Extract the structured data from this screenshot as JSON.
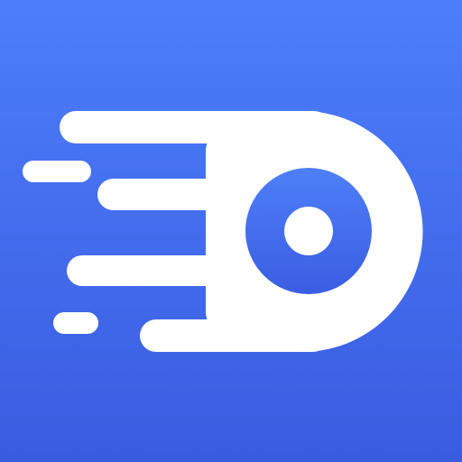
{
  "icon": {
    "name": "speed-disc-logo",
    "colors": {
      "background_top": "#4C7EFB",
      "background_bottom": "#3A5CE0",
      "glyph": "#FFFFFF",
      "ring_top": "#4E7FF8",
      "ring_bottom": "#3B5DE2"
    }
  }
}
